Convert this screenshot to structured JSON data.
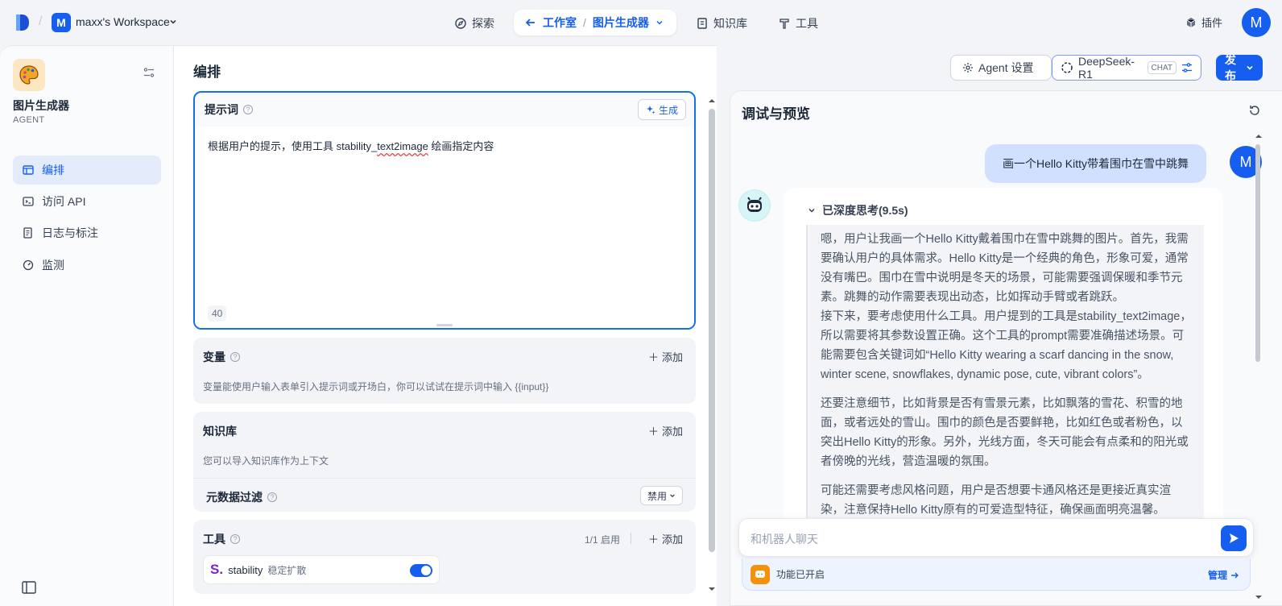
{
  "topbar": {
    "workspace_initial": "M",
    "workspace_name": "maxx's Workspace",
    "nav": {
      "explore": "探索",
      "studio": "工作室",
      "app_switch": "图片生成器",
      "knowledge": "知识库",
      "tools": "工具"
    },
    "plugin": "插件",
    "user_initial": "M"
  },
  "sidebar": {
    "app_name": "图片生成器",
    "app_type": "AGENT",
    "items": [
      {
        "label": "编排",
        "icon": "layout-icon"
      },
      {
        "label": "访问 API",
        "icon": "terminal-icon"
      },
      {
        "label": "日志与标注",
        "icon": "file-list-icon"
      },
      {
        "label": "监测",
        "icon": "dashboard-icon"
      }
    ]
  },
  "orchestrate": {
    "title": "编排",
    "prompt": {
      "label": "提示词",
      "generate_label": "生成",
      "text_before": "根据用户的提示，使用工具 stability_",
      "text_spell": "text2image",
      "text_after": " 绘画指定内容",
      "char_count": "40"
    },
    "variables": {
      "label": "变量",
      "add_label": "添加",
      "desc": "变量能使用户输入表单引入提示词或开场白，你可以试试在提示词中输入 {{input}}"
    },
    "knowledge": {
      "label": "知识库",
      "add_label": "添加",
      "desc": "您可以导入知识库作为上下文",
      "metadata_filter_label": "元数据过滤",
      "metadata_filter_value": "禁用"
    },
    "tools": {
      "label": "工具",
      "enabled_count": "1/1 启用",
      "add_label": "添加",
      "items": [
        {
          "icon_text": "S.",
          "name": "stability",
          "desc": "稳定扩散",
          "enabled": true
        }
      ]
    }
  },
  "header": {
    "agent_settings": "Agent 设置",
    "model_name": "DeepSeek-R1",
    "model_tag": "CHAT",
    "publish": "发布"
  },
  "debug": {
    "title": "调试与预览",
    "user_initial": "M",
    "user_message": "画一个Hello Kitty带着围巾在雪中跳舞",
    "thinking_label": "已深度思考(9.5s)",
    "thinking_paragraphs": [
      "嗯，用户让我画一个Hello Kitty戴着围巾在雪中跳舞的图片。首先，我需要确认用户的具体需求。Hello Kitty是一个经典的角色，形象可爱，通常没有嘴巴。围巾在雪中说明是冬天的场景，可能需要强调保暖和季节元素。跳舞的动作需要表现出动态，比如挥动手臂或者跳跃。",
      "接下来，要考虑使用什么工具。用户提到的工具是stability_text2image，所以需要将其参数设置正确。这个工具的prompt需要准确描述场景。可能需要包含关键词如“Hello Kitty wearing a scarf dancing in the snow, winter scene, snowflakes, dynamic pose, cute, vibrant colors”。",
      "还要注意细节，比如背景是否有雪景元素，比如飘落的雪花、积雪的地面，或者远处的雪山。围巾的颜色是否要鲜艳，比如红色或者粉色，以突出Hello Kitty的形象。另外，光线方面，冬天可能会有点柔和的阳光或者傍晚的光线，营造温暖的氛围。",
      "可能还需要考虑风格问题，用户是否想要卡通风格还是更接近真实渲染，注意保持Hello Kitty原有的可爱造型特征，确保画面明亮温馨。"
    ],
    "input_placeholder": "和机器人聊天",
    "feature_status": "功能已开启",
    "manage_label": "管理"
  }
}
